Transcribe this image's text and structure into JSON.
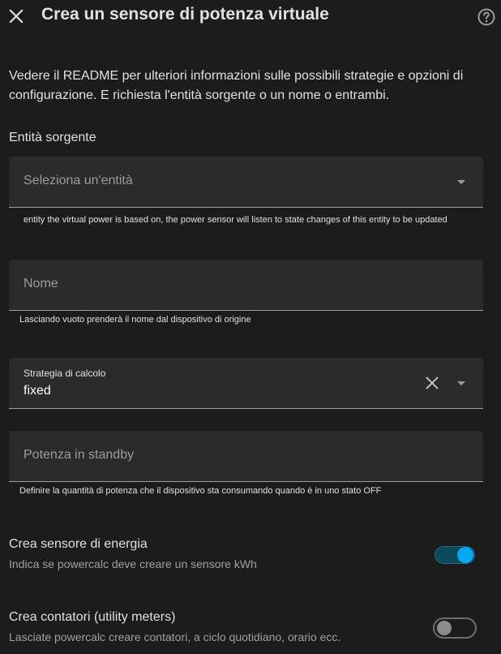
{
  "dialog": {
    "title": "Crea un sensore di potenza virtuale",
    "intro": "Vedere il README per ulteriori informazioni sulle possibili strategie e opzioni di configurazione. E richiesta l'entità sorgente o un nome o entrambi.",
    "icons": {
      "close": "close-icon",
      "help": "help-circle-icon"
    }
  },
  "form": {
    "source_entity": {
      "section_label": "Entità sorgente",
      "placeholder": "Seleziona un'entità",
      "helper": "entity the virtual power is based on, the power sensor will listen to state changes of this entity to be updated"
    },
    "name": {
      "placeholder": "Nome",
      "helper": "Lasciando vuoto prenderà il nome dal dispositivo di origine"
    },
    "strategy": {
      "label": "Strategia di calcolo",
      "value": "fixed"
    },
    "standby_power": {
      "placeholder": "Potenza in standby",
      "helper": "Definire la quantità di potenza che il dispositivo sta consumando quando è in uno stato OFF"
    },
    "create_energy_sensor": {
      "title": "Crea sensore di energia",
      "description": "Indica se powercalc deve creare un sensore kWh",
      "enabled": true
    },
    "create_utility_meters": {
      "title": "Crea contatori (utility meters)",
      "description": "Lasciate powercalc creare contatori, a ciclo quotidiano, orario ecc.",
      "enabled": false
    }
  },
  "colors": {
    "background": "#1c1c1c",
    "field": "#2b2b2b",
    "accent": "#03a9f4"
  }
}
